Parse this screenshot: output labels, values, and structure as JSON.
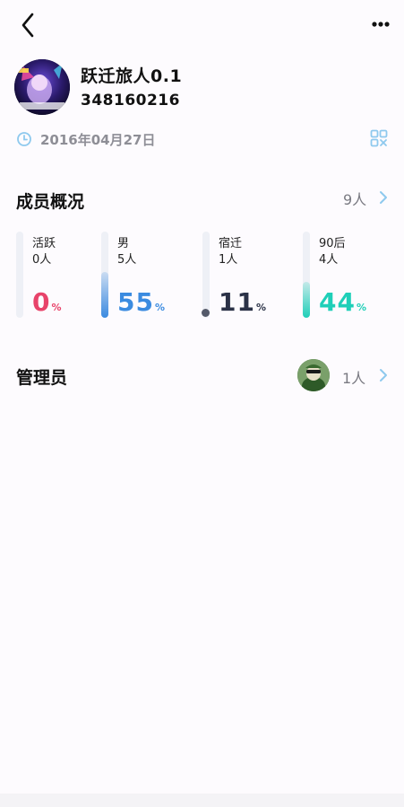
{
  "group": {
    "name": "跃迁旅人0.1",
    "id": "348160216",
    "created_date": "2016年04月27日"
  },
  "members": {
    "title": "成员概况",
    "count": "9人",
    "stats": [
      {
        "label": "活跃",
        "sub": "0人",
        "percent": "0",
        "value": 0,
        "color": "#e8436a"
      },
      {
        "label": "男",
        "sub": "5人",
        "percent": "55",
        "value": 55,
        "color": "#3b8be0"
      },
      {
        "label": "宿迁",
        "sub": "1人",
        "percent": "11",
        "value": 11,
        "color": "#2b3247"
      },
      {
        "label": "90后",
        "sub": "4人",
        "percent": "44",
        "value": 44,
        "color": "#1fcfb8"
      }
    ],
    "percent_sign": "%"
  },
  "admins": {
    "title": "管理员",
    "count": "1人"
  },
  "icons": {
    "back": "back-arrow-icon",
    "more": "more-dots-icon",
    "clock": "clock-icon",
    "qr": "qr-code-icon",
    "chevron": "chevron-right-icon"
  },
  "colors": {
    "accent": "#3b8be0",
    "chevron": "#8ec9ee",
    "muted": "#8e8e96"
  }
}
